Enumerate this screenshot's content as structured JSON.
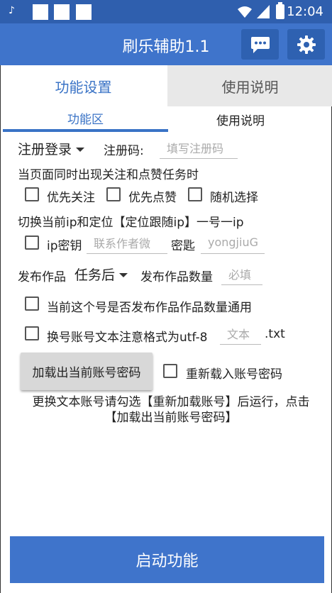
{
  "statusbar": {
    "time": "12:04",
    "icons": [
      "tiktok-icon",
      "notification-square-icon",
      "notification-square-icon",
      "notification-square-icon",
      "wifi-icon",
      "signal-icon",
      "battery-charging-icon"
    ]
  },
  "appbar": {
    "title": "刷乐辅助1.1",
    "buttons": [
      "chat-bubble-icon",
      "gear-icon"
    ]
  },
  "tabs": [
    {
      "label": "功能设置",
      "active": true
    },
    {
      "label": "使用说明",
      "active": false
    }
  ],
  "subtabs": [
    {
      "label": "功能区",
      "active": true
    },
    {
      "label": "使用说明",
      "active": false
    }
  ],
  "login": {
    "mode_selected": "注册登录",
    "reg_label": "注册码:",
    "reg_placeholder": "填写注册码"
  },
  "task_conflict": {
    "label": "当页面同时出现关注和点赞任务时",
    "options": [
      {
        "label": "优先关注",
        "checked": false
      },
      {
        "label": "优先点赞",
        "checked": false
      },
      {
        "label": "随机选择",
        "checked": false
      }
    ]
  },
  "ip": {
    "label": "切换当前ip和定位【定位跟随ip】一号一ip",
    "key_label": "ip密钥",
    "key_checked": false,
    "key_placeholder": "联系作者微",
    "secret_label": "密匙",
    "secret_placeholder": "yongjiuG"
  },
  "publish": {
    "label": "发布作品",
    "timing_selected": "任务后",
    "count_label": "发布作品数量",
    "count_placeholder": "必填",
    "shared_label": "当前这个号是否发布作品作品数量通用",
    "shared_checked": false
  },
  "account_switch": {
    "label": "换号账号文本注意格式为utf-8",
    "checked": false,
    "file_placeholder": "文本",
    "file_ext": ".txt"
  },
  "load_button": "加载出当前账号密码",
  "reload": {
    "label": "重新载入账号密码",
    "checked": false
  },
  "hint": "更换文本账号请勾选【重新加载账号】后运行，点击【加载出当前账号密码】",
  "start_button": "启动功能",
  "colors": {
    "primary": "#3f74cb",
    "statusbar": "#2f5fae",
    "accent_text": "#3a73c6"
  }
}
